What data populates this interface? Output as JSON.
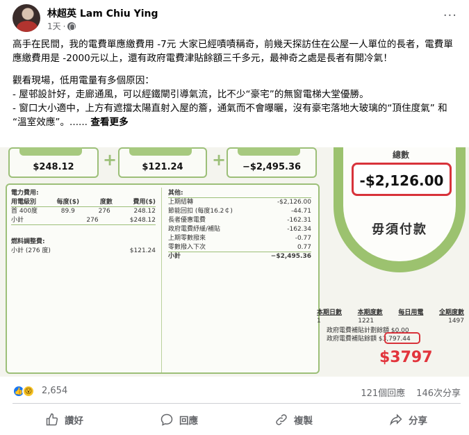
{
  "post": {
    "author": "林超英 Lam Chiu Ying",
    "time": "1天",
    "dot": "·",
    "more": "···",
    "paragraph1": "高手在民間，我的電費單應繳費用 -7元 大家已經嘖嘖稱奇，前幾天探訪住在公屋一人單位的長者，電費單應繳費用是 -2000元以上，還有政府電費津貼餘額三千多元，最神奇之處是長者有開冷氣！",
    "paragraph2_l1": "觀看現場，低用電量有多個原因：",
    "paragraph2_l2": "- 屋邨設計好，走廊通風，可以經鐵閘引導氣流，比不少“豪宅”的無窗電梯大堂優勝。",
    "paragraph2_l3": "- 窗口大小適中，上方有遮擋太陽直射入屋的簷，通氣而不會曝曬，沒有豪宅落地大玻璃的“頂住度氣” 和 “溫室效應”。......",
    "see_more": "查看更多"
  },
  "bill": {
    "box1_amount": "$248.12",
    "box2_amount": "$121.24",
    "box3_amount": "−$2,495.36",
    "total_label": "總數",
    "total_amount": "-$2,126.00",
    "no_payment": "毋須付款",
    "left_col": {
      "title": "電力費用:",
      "headers": [
        "用電級別",
        "每度($)",
        "度數",
        "費用($)"
      ],
      "row1": [
        "首 400度",
        "89.9",
        "276",
        "248.12"
      ],
      "subtotal_label": "小計",
      "subtotal_units": "276",
      "subtotal_amount": "$248.12",
      "fuel_title": "燃料調整費:",
      "fuel_row_label": "小計 (276 度)",
      "fuel_row_amount": "$121.24"
    },
    "right_col": {
      "title": "其他:",
      "rows": [
        [
          "上期結轉",
          "-$2,126.00"
        ],
        [
          "節能回扣 (每度16.2￠)",
          "-44.71"
        ],
        [
          "長者優惠電費",
          "-162.31"
        ],
        [
          "政府電費紓緩/補貼",
          "-162.34"
        ],
        [
          "上期零數撥來",
          "-0.77"
        ],
        [
          "零數撥入下次",
          "0.77"
        ],
        [
          "小計",
          "−$2,495.36"
        ]
      ]
    },
    "stats_headers": [
      "本期日數",
      "本期度數",
      "每日用電",
      "全期度數"
    ],
    "stats_values": [
      "1",
      "1221",
      "",
      "1497"
    ],
    "subsidy_l1": "政府電費補貼計劃餘額 $0.00",
    "subsidy_l2": "政府電費補貼餘額 $3,797.44",
    "big_red": "$3797"
  },
  "reactions": {
    "count": "2,654",
    "comments": "121個回應",
    "shares": "146次分享"
  },
  "actions": {
    "like": "讚好",
    "comment": "回應",
    "copy": "複製",
    "share": "分享"
  }
}
